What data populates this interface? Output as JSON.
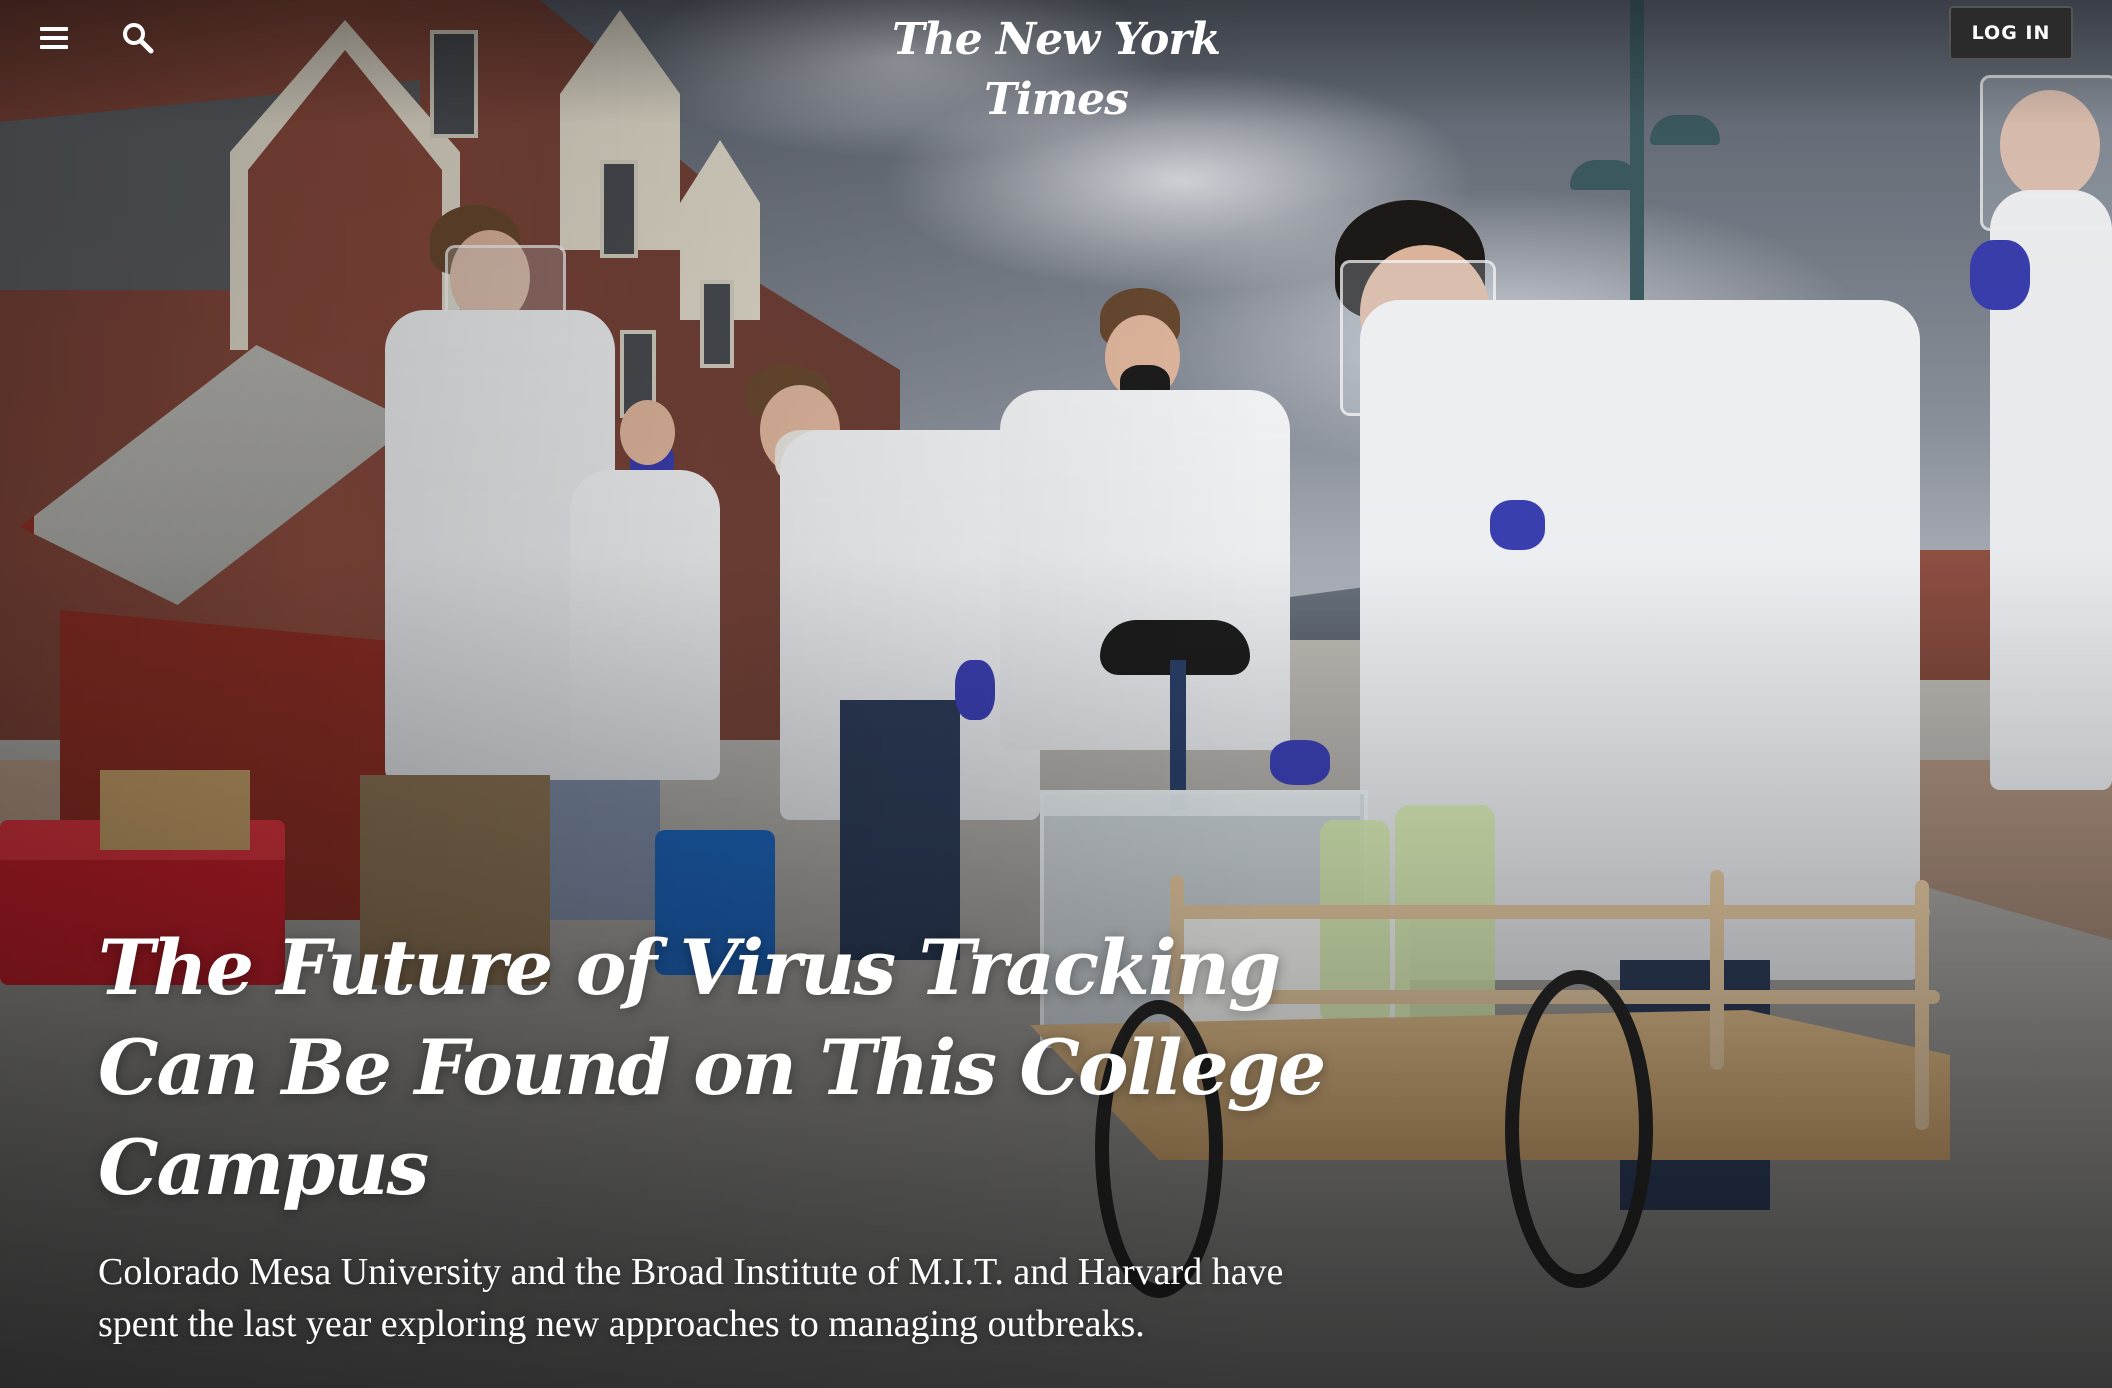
{
  "header": {
    "logo_text": "The New York Times",
    "login_label": "LOG IN",
    "menu_icon": "hamburger-menu-icon",
    "search_icon": "search-icon"
  },
  "article": {
    "headline": "The Future of Virus Tracking Can Be Found on This College Campus",
    "summary": "Colorado Mesa University and the Broad Institute of M.I.T. and Harvard have spent the last year exploring new approaches to managing outbreaks."
  },
  "colors": {
    "text": "#ffffff",
    "login_bg": "#2b2b2b",
    "cooler_red": "#c8202c",
    "glove_blue": "#3a3fb0"
  }
}
